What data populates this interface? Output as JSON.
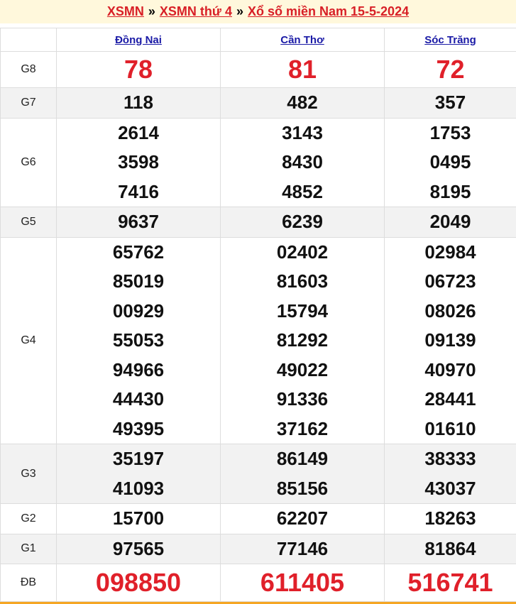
{
  "breadcrumb": {
    "link1": "XSMN",
    "sep": "»",
    "link2": "XSMN thứ 4",
    "link3": "Xổ số miền Nam 15-5-2024"
  },
  "provinces": [
    "Đồng Nai",
    "Cần Thơ",
    "Sóc Trăng"
  ],
  "prizes": [
    {
      "label": "G8",
      "values": [
        [
          "78"
        ],
        [
          "81"
        ],
        [
          "72"
        ]
      ]
    },
    {
      "label": "G7",
      "values": [
        [
          "118"
        ],
        [
          "482"
        ],
        [
          "357"
        ]
      ]
    },
    {
      "label": "G6",
      "values": [
        [
          "2614",
          "3598",
          "7416"
        ],
        [
          "3143",
          "8430",
          "4852"
        ],
        [
          "1753",
          "0495",
          "8195"
        ]
      ]
    },
    {
      "label": "G5",
      "values": [
        [
          "9637"
        ],
        [
          "6239"
        ],
        [
          "2049"
        ]
      ]
    },
    {
      "label": "G4",
      "values": [
        [
          "65762",
          "85019",
          "00929",
          "55053",
          "94966",
          "44430",
          "49395"
        ],
        [
          "02402",
          "81603",
          "15794",
          "81292",
          "49022",
          "91336",
          "37162"
        ],
        [
          "02984",
          "06723",
          "08026",
          "09139",
          "40970",
          "28441",
          "01610"
        ]
      ]
    },
    {
      "label": "G3",
      "values": [
        [
          "35197",
          "41093"
        ],
        [
          "86149",
          "85156"
        ],
        [
          "38333",
          "43037"
        ]
      ]
    },
    {
      "label": "G2",
      "values": [
        [
          "15700"
        ],
        [
          "62207"
        ],
        [
          "18263"
        ]
      ]
    },
    {
      "label": "G1",
      "values": [
        [
          "97565"
        ],
        [
          "77146"
        ],
        [
          "81864"
        ]
      ]
    },
    {
      "label": "ĐB",
      "values": [
        [
          "098850"
        ],
        [
          "611405"
        ],
        [
          "516741"
        ]
      ]
    }
  ],
  "colors": {
    "accent_red": "#e0202a",
    "link_blue": "#1a1aa6",
    "title_bg": "#fff8dc",
    "shade": "#f2f2f2"
  }
}
